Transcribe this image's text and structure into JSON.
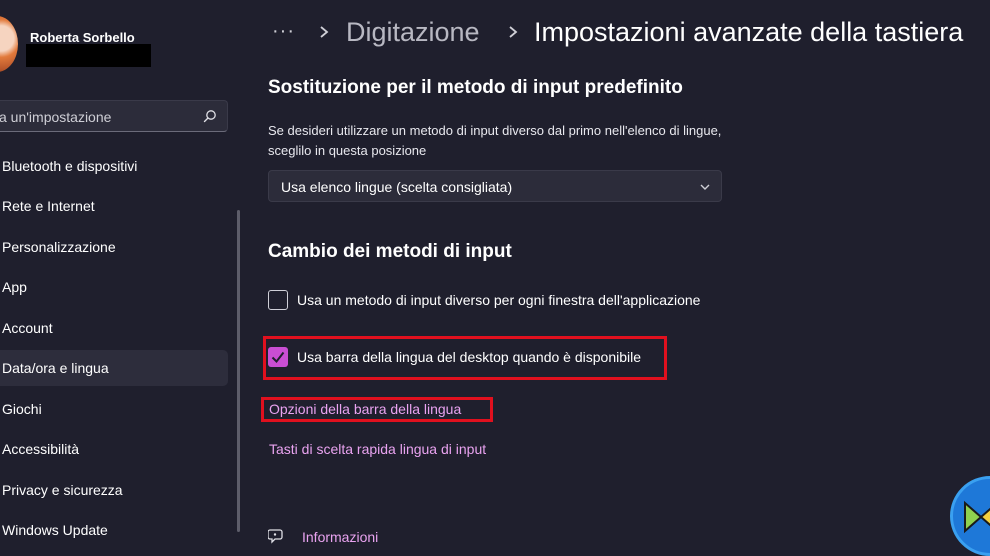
{
  "user": {
    "name": "Roberta Sorbello"
  },
  "search": {
    "text": "a un'impostazione"
  },
  "sidebar": {
    "items": [
      {
        "label": "Bluetooth e dispositivi"
      },
      {
        "label": "Rete e Internet"
      },
      {
        "label": "Personalizzazione"
      },
      {
        "label": "App"
      },
      {
        "label": "Account"
      },
      {
        "label": "Data/ora e lingua",
        "selected": true
      },
      {
        "label": "Giochi"
      },
      {
        "label": "Accessibilità"
      },
      {
        "label": "Privacy e sicurezza"
      },
      {
        "label": "Windows Update"
      }
    ]
  },
  "header": {
    "dots": "···",
    "crumb1": "Digitazione",
    "crumb2": "Impostazioni avanzate della tastiera"
  },
  "override": {
    "title": "Sostituzione per il metodo di input predefinito",
    "description": "Se desideri utilizzare un metodo di input diverso dal primo nell'elenco di lingue, sceglilo in questa posizione",
    "dropdown_value": "Usa elenco lingue (scelta consigliata)"
  },
  "switching": {
    "title": "Cambio dei metodi di input",
    "option1": "Usa un metodo di input diverso per ogni finestra dell'applicazione",
    "option1_checked": false,
    "option2": "Usa barra della lingua del desktop quando è disponibile",
    "option2_checked": true,
    "link1": "Opzioni della barra della lingua",
    "link2": "Tasti di scelta rapida lingua di input"
  },
  "footer": {
    "info": "Informazioni"
  },
  "colors": {
    "background": "#1f1f2d",
    "accent": "#c94ed3",
    "link": "#e9a3f0",
    "highlight": "#e0101e"
  }
}
